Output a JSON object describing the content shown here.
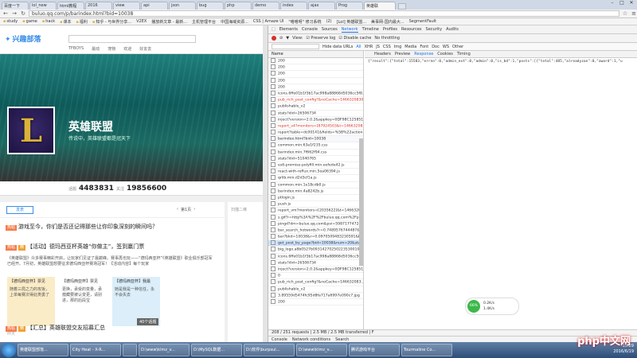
{
  "browser": {
    "tabs": [
      "百度一下",
      "lol_new",
      "html教程",
      "2016",
      "view",
      "api",
      "json",
      "bug",
      "php",
      "demo",
      "index",
      "ajax",
      "Prog",
      "英雄联"
    ],
    "window_controls": [
      "–",
      "□",
      "✕"
    ],
    "url": "buluo.qq.com/p/barindex.html?bid=10038",
    "bookmarks": [
      "study",
      "game",
      "hack",
      "课本",
      "福利",
      "知乎 - 与世界分享...",
      "V2EX",
      "播放新文章 - 最新...",
      "主机管理平台",
      "中国海域资源...",
      "CSS | Amaze UI",
      "\"嗒嗒呀\" 修习系统",
      "(2)",
      "[Lol] 英雄联盟...",
      "美事网-国内最大...",
      "SegmentFault"
    ]
  },
  "site": {
    "logo": "兴趣部落",
    "nav": [
      "TFBOYS",
      "最动",
      "宠物",
      "欢迎",
      "好友去"
    ],
    "bar_name": "英雄联盟",
    "bar_desc": "传说中，英雄联盟都是冠天下",
    "stats": [
      {
        "label": "话题",
        "value": "4483831"
      },
      {
        "label": "关注",
        "value": "19856600"
      }
    ],
    "post_button": "发表",
    "pager": "第1页",
    "side_title": "扫描二维",
    "feed": {
      "post1_title": "游戏至今，你们是否还记得那些让你印象深刻的瞬间吗？",
      "post2_title": "【活动】德玛西亚杯英雄“你做主”，签到赢门票",
      "post2_body": "《英雄联盟》众多赛事精彩开启，让玩家们见证了最巅峰。赛事再也玩——“德玛西亚杯”《英雄联盟》职业俱乐部冠军已经开。7月初，英雄联盟想要征求德玛西亚杯赛场冠军！【活动内容】每个玩家",
      "cards": [
        {
          "title": "【德玛西亚杯】票见",
          "body": "随着三局之力的攻坂，上单每赛次得此类勇了"
        },
        {
          "title": "【德玛西亚杯】票见",
          "body": "更换，承受的变量，承蕴藏要被认变更，请别进，那的后段宝"
        },
        {
          "title": "【德玛西亚杯】我最",
          "body": "她是我是一种信任，永不会失去"
        }
      ],
      "card_badge": "40个话题",
      "date": "昨天",
      "post3_title": "【汇总】英雄联盟交友招募汇总"
    }
  },
  "devtools": {
    "tabs": [
      "Elements",
      "Console",
      "Sources",
      "Network",
      "Timeline",
      "Profiles",
      "Resources",
      "Security",
      "Audits"
    ],
    "active_tab": "Network",
    "controls": [
      "View:",
      "Preserve log",
      "Disable cache",
      "No throttling"
    ],
    "filter_types": [
      "Hide data URLs",
      "All",
      "XHR",
      "JS",
      "CSS",
      "Img",
      "Media",
      "Font",
      "Doc",
      "WS",
      "Other"
    ],
    "name_header": "Name",
    "rows": [
      "200",
      "200",
      "200",
      "200",
      "200",
      "icons.6ffe01b1f3b17ac998a88868d5036cc5f8.png",
      "pub_rich_post_config?&noCache=1466320830...",
      "publishable_v2",
      "stats?did=26506734",
      "inject?version=2.0.2&appkey=0DF98C12585158...",
      "report_v4?monitors=[87924503&t=1466320830...",
      "report?table=dc00141&fields=%5B%22action...",
      "barindex.html?bid=10038",
      "common.min.63a1f235.css",
      "barindex.min.7f662f94.css",
      "stats?did=51040765",
      "es6-promise-polyfill.min.eefede42.js",
      "react-with-reflux.min.5ea06394.js",
      "qrlib.min.d2d3cf1a.js",
      "common.min.1e18cdb0.js",
      "barindex.min.4a8242b.js",
      "ptlogin.js",
      "push.js",
      "report_vm?monitors=[2035622]&t=146632083...",
      "s.gif?r=http%3A%2F%2Fbuluo.qq.com%2Fp%2...",
      "pingd?dm=buluo.qq.com&pvi=59871774728&si...",
      "bar_search_hotwords?r=0.7489576744487&b...",
      "bar?bkd=10038&r=0.0970509483230591&bid=...",
      "get_post_by_page?bid=10038&num=20&start...",
      "big_logo.a8b0527b09314270250223530010463...",
      "icons.6ffe01b1f3b17ac998a88868d5036cc5f8.png",
      "stats?did=26506734",
      "inject?version=2.0.2&appkey=0DF98C12585158...",
      "0",
      "pub_rich_post_config?&noCache=146632083...",
      "publishable_v2",
      "3.89559d5474fc95d8fa717a6997e090c7.jpg",
      "200"
    ],
    "detail_tabs": [
      "Headers",
      "Preview",
      "Response",
      "Cookies",
      "Timing"
    ],
    "response": "{\"result\":{\"total\":15583,\"errno\":0,\"admin_ext\":0,\"admin\":0,\"is_bd\":1,\"posts\":[{\"total\":485,\"alreadyzan\":0,\"award\":1,\"u",
    "status": "208 / 251 requests  |  2.5 MB / 2.5 MB transferred  |  F",
    "drawer": [
      "Console",
      "Network conditions",
      "Search"
    ],
    "widget": {
      "ball": "66%",
      "up": "0.2K/s",
      "down": "1.4K/s"
    }
  },
  "taskbar": {
    "tasks": [
      "英雄联盟部落...",
      "City Heat - X-R...",
      "",
      "D:\\www\\klmz_v...",
      "D:\\MySQL数据...",
      "D:\\软件\\burpsui...",
      "D:\\www\\klmz_v...",
      "腾讯游戏平台",
      "Tourmaline Co..."
    ],
    "time": "15:29",
    "date": "2016/6/19",
    "watermark": "php中文网"
  }
}
